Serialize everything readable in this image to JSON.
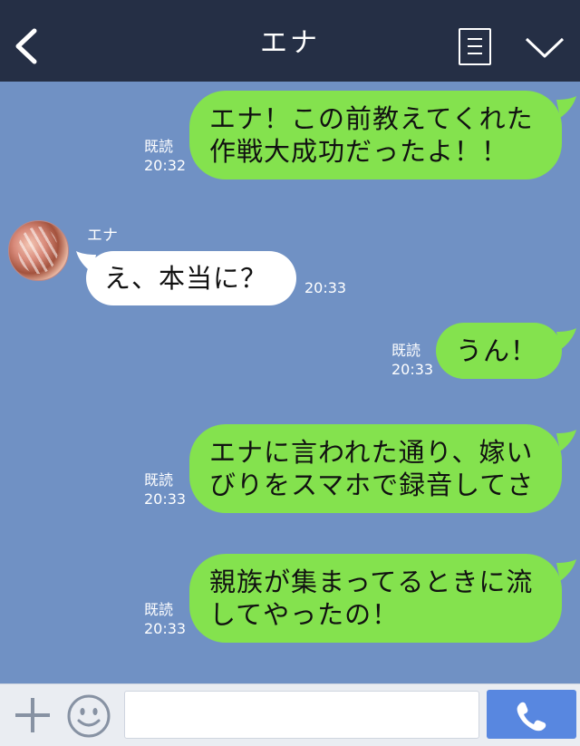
{
  "header": {
    "title": "エナ"
  },
  "messages": [
    {
      "side": "out",
      "lines": [
        "エナ！この前教えてくれた",
        "作戦大成功だったよ！！"
      ],
      "read": "既読",
      "time": "20:32"
    },
    {
      "side": "in",
      "sender": "エナ",
      "lines": [
        "え、本当に？"
      ],
      "time": "20:33"
    },
    {
      "side": "out",
      "lines": [
        "うん！"
      ],
      "read": "既読",
      "time": "20:33"
    },
    {
      "side": "out",
      "lines": [
        "エナに言われた通り、嫁い",
        "びりをスマホで録音してさ"
      ],
      "read": "既読",
      "time": "20:33"
    },
    {
      "side": "out",
      "lines": [
        "親族が集まってるときに流",
        "してやったの！"
      ],
      "read": "既読",
      "time": "20:33"
    }
  ],
  "input": {
    "value": ""
  },
  "colors": {
    "header": "#252f45",
    "chat_background": "#7091c4",
    "outgoing_bubble": "#84e24e",
    "incoming_bubble": "#ffffff",
    "call_button": "#5887e0"
  },
  "icons": {
    "back": "back-arrow-icon",
    "menu": "list-menu-icon",
    "expand": "chevron-down-icon",
    "add": "plus-icon",
    "sticker": "smiley-icon",
    "call": "phone-icon"
  }
}
